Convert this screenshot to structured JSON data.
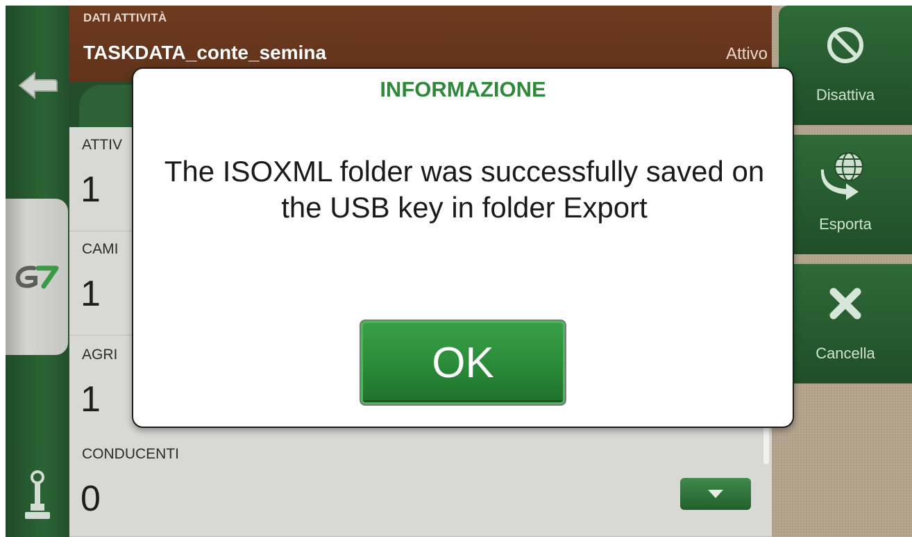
{
  "header": {
    "section_label": "DATI ATTIVITÀ",
    "task_name": "TASKDATA_conte_semina",
    "status": "Attivo"
  },
  "fields": [
    {
      "label": "ATTIV",
      "value": "1"
    },
    {
      "label": "CAMI",
      "value": "1"
    },
    {
      "label": "AGRI",
      "value": "1"
    },
    {
      "label": "CONDUCENTI",
      "value": "0"
    }
  ],
  "actions": [
    {
      "label": "Disattiva",
      "icon": "prohibit-icon"
    },
    {
      "label": "Esporta",
      "icon": "globe-export-icon"
    },
    {
      "label": "Cancella",
      "icon": "x-icon"
    }
  ],
  "left_rail": {
    "icons": [
      "back-arrow-icon",
      "g7-logo-icon",
      "joystick-icon"
    ],
    "logo_text": "G7"
  },
  "dialog": {
    "title": "INFORMAZIONE",
    "message": "The ISOXML folder was successfully saved on the USB key in folder Export",
    "ok_label": "OK"
  },
  "colors": {
    "brand_green": "#2e8a3a",
    "header_brown": "#6d3a1f",
    "panel_gray": "#d9d9d6"
  }
}
